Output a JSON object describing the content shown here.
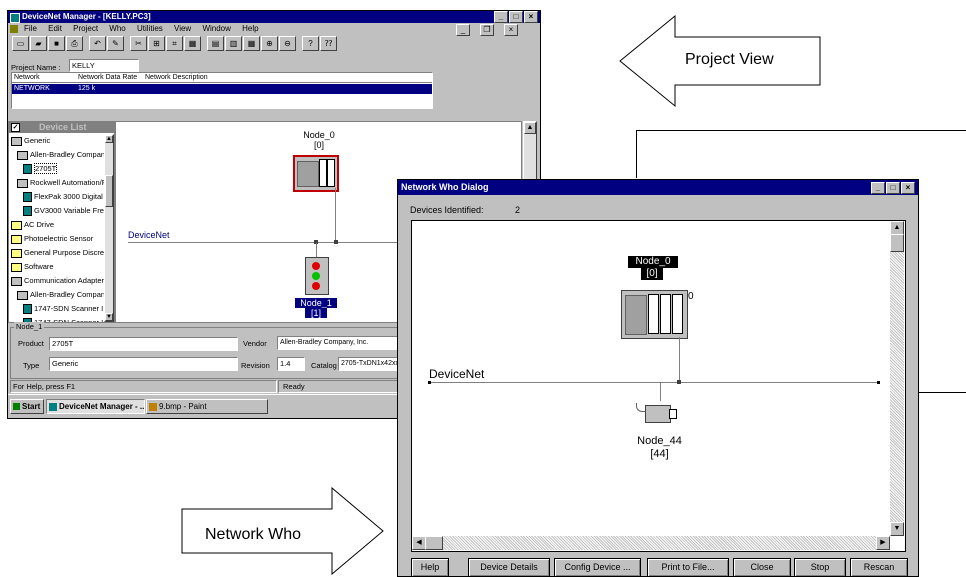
{
  "main_window": {
    "title": "DeviceNet Manager - [KELLY.PC3]",
    "menu": [
      "File",
      "Edit",
      "Project",
      "Who",
      "Utilities",
      "View",
      "Window",
      "Help"
    ],
    "project_name_label": "Project Name :",
    "project_name_value": "KELLY",
    "network_table": {
      "headers": [
        "Network",
        "Network Data Rate",
        "Network Description"
      ],
      "rows": [
        [
          "NETWORK",
          "125 k",
          ""
        ]
      ]
    },
    "device_list_title": "Device List",
    "tree": [
      {
        "label": "Generic",
        "type": "folder",
        "indent": 0
      },
      {
        "label": "Allen-Bradley Compan",
        "type": "folder",
        "indent": 1
      },
      {
        "label": "2705T",
        "type": "device",
        "indent": 2,
        "selected": true
      },
      {
        "label": "Rockwell Automation/F",
        "type": "folder",
        "indent": 1
      },
      {
        "label": "FlexPak 3000 Digital I",
        "type": "device",
        "indent": 2
      },
      {
        "label": "GV3000 Variable Fre",
        "type": "device",
        "indent": 2
      },
      {
        "label": "AC Drive",
        "type": "plus",
        "indent": 0
      },
      {
        "label": "Photoelectric Sensor",
        "type": "plus",
        "indent": 0
      },
      {
        "label": "General Purpose Discre",
        "type": "plus",
        "indent": 0
      },
      {
        "label": "Software",
        "type": "plus",
        "indent": 0
      },
      {
        "label": "Communication Adapter",
        "type": "folder",
        "indent": 0
      },
      {
        "label": "Allen-Bradley Compan",
        "type": "folder",
        "indent": 1
      },
      {
        "label": "1747-SDN Scanner I",
        "type": "device",
        "indent": 2
      },
      {
        "label": "1747-SDN Scanner I",
        "type": "device",
        "indent": 2
      }
    ],
    "canvas": {
      "node0_name": "Node_0",
      "node0_addr": "[0]",
      "bus_label": "DeviceNet",
      "node1_name": "Node_1",
      "node1_addr": "[1]"
    },
    "props": {
      "group_label": "Node_1",
      "product_label": "Product",
      "product_value": "2705T",
      "type_label": "Type",
      "type_value": "Generic",
      "vendor_label": "Vendor",
      "vendor_value": "Allen-Bradley Company, Inc.",
      "revision_label": "Revision",
      "revision_value": "1.4",
      "catalog_label": "Catalog",
      "catalog_value": "2705-TxDN1x42xx"
    },
    "status": {
      "help": "For Help, press F1",
      "state": "Ready"
    },
    "taskbar": {
      "start": "Start",
      "task1": "DeviceNet Manager - ...",
      "task2": "9.bmp - Paint"
    }
  },
  "dialog": {
    "title": "Network Who Dialog",
    "devices_label": "Devices Identified:",
    "devices_count": "2",
    "node0_name": "Node_0",
    "node0_addr": "[0]",
    "bus_label": "DeviceNet",
    "node44_name": "Node_44",
    "node44_addr": "[44]",
    "buttons": [
      "Help",
      "Device Details",
      "Config Device ...",
      "Print to File...",
      "Close",
      "Stop",
      "Rescan"
    ]
  },
  "callouts": {
    "project_view": "Project View",
    "network_who": "Network Who"
  },
  "colors": {
    "titlebar": "#000080",
    "face": "#c0c0c0",
    "selection": "#000080"
  }
}
